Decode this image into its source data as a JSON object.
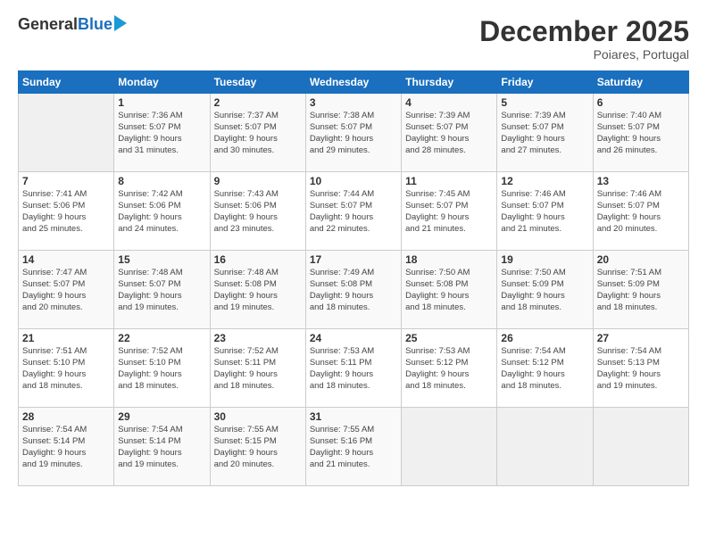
{
  "logo": {
    "general": "General",
    "blue": "Blue"
  },
  "header": {
    "month": "December 2025",
    "location": "Poiares, Portugal"
  },
  "weekdays": [
    "Sunday",
    "Monday",
    "Tuesday",
    "Wednesday",
    "Thursday",
    "Friday",
    "Saturday"
  ],
  "weeks": [
    [
      {
        "day": "",
        "info": ""
      },
      {
        "day": "1",
        "info": "Sunrise: 7:36 AM\nSunset: 5:07 PM\nDaylight: 9 hours\nand 31 minutes."
      },
      {
        "day": "2",
        "info": "Sunrise: 7:37 AM\nSunset: 5:07 PM\nDaylight: 9 hours\nand 30 minutes."
      },
      {
        "day": "3",
        "info": "Sunrise: 7:38 AM\nSunset: 5:07 PM\nDaylight: 9 hours\nand 29 minutes."
      },
      {
        "day": "4",
        "info": "Sunrise: 7:39 AM\nSunset: 5:07 PM\nDaylight: 9 hours\nand 28 minutes."
      },
      {
        "day": "5",
        "info": "Sunrise: 7:39 AM\nSunset: 5:07 PM\nDaylight: 9 hours\nand 27 minutes."
      },
      {
        "day": "6",
        "info": "Sunrise: 7:40 AM\nSunset: 5:07 PM\nDaylight: 9 hours\nand 26 minutes."
      }
    ],
    [
      {
        "day": "7",
        "info": "Sunrise: 7:41 AM\nSunset: 5:06 PM\nDaylight: 9 hours\nand 25 minutes."
      },
      {
        "day": "8",
        "info": "Sunrise: 7:42 AM\nSunset: 5:06 PM\nDaylight: 9 hours\nand 24 minutes."
      },
      {
        "day": "9",
        "info": "Sunrise: 7:43 AM\nSunset: 5:06 PM\nDaylight: 9 hours\nand 23 minutes."
      },
      {
        "day": "10",
        "info": "Sunrise: 7:44 AM\nSunset: 5:07 PM\nDaylight: 9 hours\nand 22 minutes."
      },
      {
        "day": "11",
        "info": "Sunrise: 7:45 AM\nSunset: 5:07 PM\nDaylight: 9 hours\nand 21 minutes."
      },
      {
        "day": "12",
        "info": "Sunrise: 7:46 AM\nSunset: 5:07 PM\nDaylight: 9 hours\nand 21 minutes."
      },
      {
        "day": "13",
        "info": "Sunrise: 7:46 AM\nSunset: 5:07 PM\nDaylight: 9 hours\nand 20 minutes."
      }
    ],
    [
      {
        "day": "14",
        "info": "Sunrise: 7:47 AM\nSunset: 5:07 PM\nDaylight: 9 hours\nand 20 minutes."
      },
      {
        "day": "15",
        "info": "Sunrise: 7:48 AM\nSunset: 5:07 PM\nDaylight: 9 hours\nand 19 minutes."
      },
      {
        "day": "16",
        "info": "Sunrise: 7:48 AM\nSunset: 5:08 PM\nDaylight: 9 hours\nand 19 minutes."
      },
      {
        "day": "17",
        "info": "Sunrise: 7:49 AM\nSunset: 5:08 PM\nDaylight: 9 hours\nand 18 minutes."
      },
      {
        "day": "18",
        "info": "Sunrise: 7:50 AM\nSunset: 5:08 PM\nDaylight: 9 hours\nand 18 minutes."
      },
      {
        "day": "19",
        "info": "Sunrise: 7:50 AM\nSunset: 5:09 PM\nDaylight: 9 hours\nand 18 minutes."
      },
      {
        "day": "20",
        "info": "Sunrise: 7:51 AM\nSunset: 5:09 PM\nDaylight: 9 hours\nand 18 minutes."
      }
    ],
    [
      {
        "day": "21",
        "info": "Sunrise: 7:51 AM\nSunset: 5:10 PM\nDaylight: 9 hours\nand 18 minutes."
      },
      {
        "day": "22",
        "info": "Sunrise: 7:52 AM\nSunset: 5:10 PM\nDaylight: 9 hours\nand 18 minutes."
      },
      {
        "day": "23",
        "info": "Sunrise: 7:52 AM\nSunset: 5:11 PM\nDaylight: 9 hours\nand 18 minutes."
      },
      {
        "day": "24",
        "info": "Sunrise: 7:53 AM\nSunset: 5:11 PM\nDaylight: 9 hours\nand 18 minutes."
      },
      {
        "day": "25",
        "info": "Sunrise: 7:53 AM\nSunset: 5:12 PM\nDaylight: 9 hours\nand 18 minutes."
      },
      {
        "day": "26",
        "info": "Sunrise: 7:54 AM\nSunset: 5:12 PM\nDaylight: 9 hours\nand 18 minutes."
      },
      {
        "day": "27",
        "info": "Sunrise: 7:54 AM\nSunset: 5:13 PM\nDaylight: 9 hours\nand 19 minutes."
      }
    ],
    [
      {
        "day": "28",
        "info": "Sunrise: 7:54 AM\nSunset: 5:14 PM\nDaylight: 9 hours\nand 19 minutes."
      },
      {
        "day": "29",
        "info": "Sunrise: 7:54 AM\nSunset: 5:14 PM\nDaylight: 9 hours\nand 19 minutes."
      },
      {
        "day": "30",
        "info": "Sunrise: 7:55 AM\nSunset: 5:15 PM\nDaylight: 9 hours\nand 20 minutes."
      },
      {
        "day": "31",
        "info": "Sunrise: 7:55 AM\nSunset: 5:16 PM\nDaylight: 9 hours\nand 21 minutes."
      },
      {
        "day": "",
        "info": ""
      },
      {
        "day": "",
        "info": ""
      },
      {
        "day": "",
        "info": ""
      }
    ]
  ]
}
